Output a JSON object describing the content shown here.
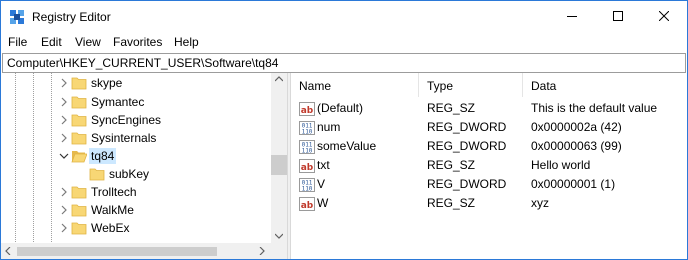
{
  "window": {
    "title": "Registry Editor"
  },
  "menu": [
    "File",
    "Edit",
    "View",
    "Favorites",
    "Help"
  ],
  "address": {
    "path": "Computer\\HKEY_CURRENT_USER\\Software\\tq84"
  },
  "tree": {
    "items": [
      {
        "label": "skype",
        "expandable": true,
        "selected": false,
        "level": 0
      },
      {
        "label": "Symantec",
        "expandable": true,
        "selected": false,
        "level": 0
      },
      {
        "label": "SyncEngines",
        "expandable": true,
        "selected": false,
        "level": 0
      },
      {
        "label": "Sysinternals",
        "expandable": true,
        "selected": false,
        "level": 0
      },
      {
        "label": "tq84",
        "expandable": true,
        "expanded": true,
        "selected": true,
        "level": 0
      },
      {
        "label": "subKey",
        "expandable": false,
        "selected": false,
        "level": 1
      },
      {
        "label": "Trolltech",
        "expandable": true,
        "selected": false,
        "level": 0
      },
      {
        "label": "WalkMe",
        "expandable": true,
        "selected": false,
        "level": 0
      },
      {
        "label": "WebEx",
        "expandable": true,
        "selected": false,
        "level": 0
      }
    ]
  },
  "values": {
    "columns": [
      "Name",
      "Type",
      "Data"
    ],
    "rows": [
      {
        "icon": "string-value-icon",
        "name": "(Default)",
        "type": "REG_SZ",
        "data": "This is the default value"
      },
      {
        "icon": "binary-value-icon",
        "name": "num",
        "type": "REG_DWORD",
        "data": "0x0000002a (42)"
      },
      {
        "icon": "binary-value-icon",
        "name": "someValue",
        "type": "REG_DWORD",
        "data": "0x00000063 (99)"
      },
      {
        "icon": "string-value-icon",
        "name": "txt",
        "type": "REG_SZ",
        "data": "Hello world"
      },
      {
        "icon": "binary-value-icon",
        "name": "V",
        "type": "REG_DWORD",
        "data": "0x00000001 (1)"
      },
      {
        "icon": "string-value-icon",
        "name": "W",
        "type": "REG_SZ",
        "data": "xyz"
      }
    ]
  },
  "colors": {
    "accent_border": "#2b79d8",
    "selection": "#cce8ff",
    "folder": "#f8d775",
    "string_icon": "#c0392b",
    "dword_icon": "#2b5797"
  }
}
